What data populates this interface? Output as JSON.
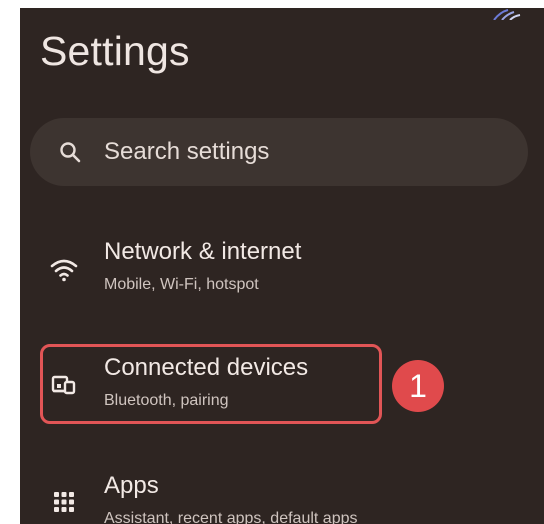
{
  "page": {
    "title": "Settings"
  },
  "search": {
    "placeholder": "Search settings",
    "icon": "search-icon"
  },
  "items": [
    {
      "label": "Network & internet",
      "sub": "Mobile, Wi-Fi, hotspot",
      "icon": "wifi-icon"
    },
    {
      "label": "Connected devices",
      "sub": "Bluetooth, pairing",
      "icon": "connected-devices-icon"
    },
    {
      "label": "Apps",
      "sub": "Assistant, recent apps, default apps",
      "icon": "apps-grid-icon"
    }
  ],
  "annotation": {
    "step_number": "1",
    "color": "#e15556"
  },
  "colors": {
    "background": "#2e2522",
    "search_bg": "#3d3430",
    "text_primary": "#f2e9e5",
    "text_secondary": "#cfc4bf"
  }
}
